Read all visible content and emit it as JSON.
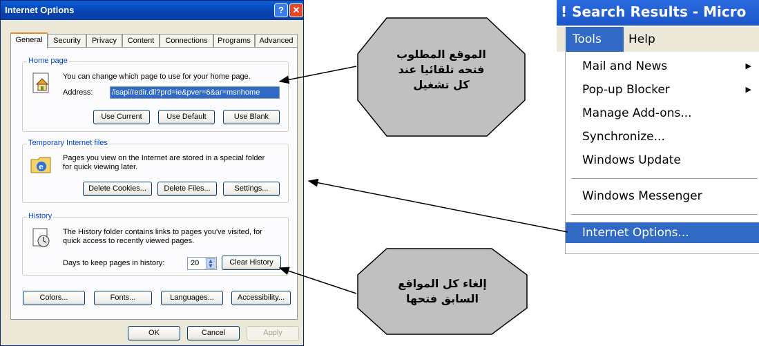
{
  "dialog": {
    "title": "Internet Options",
    "help_glyph": "?",
    "close_glyph": "✕",
    "tabs": [
      "General",
      "Security",
      "Privacy",
      "Content",
      "Connections",
      "Programs",
      "Advanced"
    ],
    "home_page": {
      "legend": "Home page",
      "description": "You can change which page to use for your home page.",
      "address_label": "Address:",
      "address_value": "/isapi/redir.dll?prd=ie&pver=6&ar=msnhome",
      "buttons": [
        "Use Current",
        "Use Default",
        "Use Blank"
      ]
    },
    "temp_files": {
      "legend": "Temporary Internet files",
      "line1": "Pages you view on the Internet are stored in a special folder",
      "line2": "for quick viewing later.",
      "buttons": [
        "Delete Cookies...",
        "Delete Files...",
        "Settings..."
      ]
    },
    "history": {
      "legend": "History",
      "line1": "The History folder contains links to pages you've visited, for",
      "line2": "quick access to recently viewed pages.",
      "days_label": "Days to keep pages in history:",
      "days_value": "20",
      "clear_button": "Clear History"
    },
    "bottom_buttons": [
      "Colors...",
      "Fonts...",
      "Languages...",
      "Accessibility..."
    ],
    "footer_buttons": [
      "OK",
      "Cancel",
      "Apply"
    ]
  },
  "menu": {
    "window_title": "! Search Results - Micro",
    "menubar": {
      "tools": "Tools",
      "help": "Help"
    },
    "items": [
      "Mail and News",
      "Pop-up Blocker",
      "Manage Add-ons...",
      "Synchronize...",
      "Windows Update",
      "Windows Messenger",
      "Internet Options..."
    ]
  },
  "callouts": {
    "top": {
      "line1": "الموقع المطلوب",
      "line2": "فتحه تلقائيا عند",
      "line3": "كل تشغيل"
    },
    "bottom": {
      "line1": "إلغاء كل المواقع",
      "line2": "السابق فتحها"
    }
  },
  "colors": {
    "title_bar": "#0A5FD8",
    "selection": "#316AC5",
    "callout_fill": "#C0C0C0",
    "dialog_face": "#ECE9D8"
  }
}
